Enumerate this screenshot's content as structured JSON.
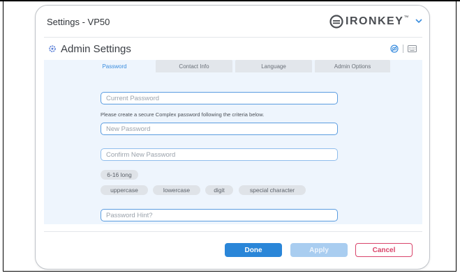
{
  "window": {
    "title": "Settings - VP50"
  },
  "brand": {
    "name": "IRONKEY",
    "trademark": "™"
  },
  "header": {
    "title": "Admin Settings"
  },
  "tabs": [
    {
      "label": "Password",
      "active": true
    },
    {
      "label": "Contact Info",
      "active": false
    },
    {
      "label": "Language",
      "active": false
    },
    {
      "label": "Admin Options",
      "active": false
    }
  ],
  "form": {
    "current_password_placeholder": "Current Password",
    "criteria_text": "Please create a secure Complex password following the criteria below.",
    "new_password_placeholder": "New Password",
    "confirm_password_placeholder": "Confirm New Password",
    "password_hint_placeholder": "Password Hint?"
  },
  "criteria": {
    "length": "6-16 long",
    "items": [
      "uppercase",
      "lowercase",
      "digit",
      "special character"
    ]
  },
  "actions": {
    "done": "Done",
    "apply": "Apply",
    "cancel": "Cancel"
  },
  "colors": {
    "accent": "#2a86d8",
    "cancel": "#d9446a",
    "panel": "#eef5fd"
  },
  "icons": [
    "ironkey-logo-icon",
    "chevron-down-icon",
    "gear-icon",
    "eye-slash-icon",
    "keyboard-icon"
  ]
}
